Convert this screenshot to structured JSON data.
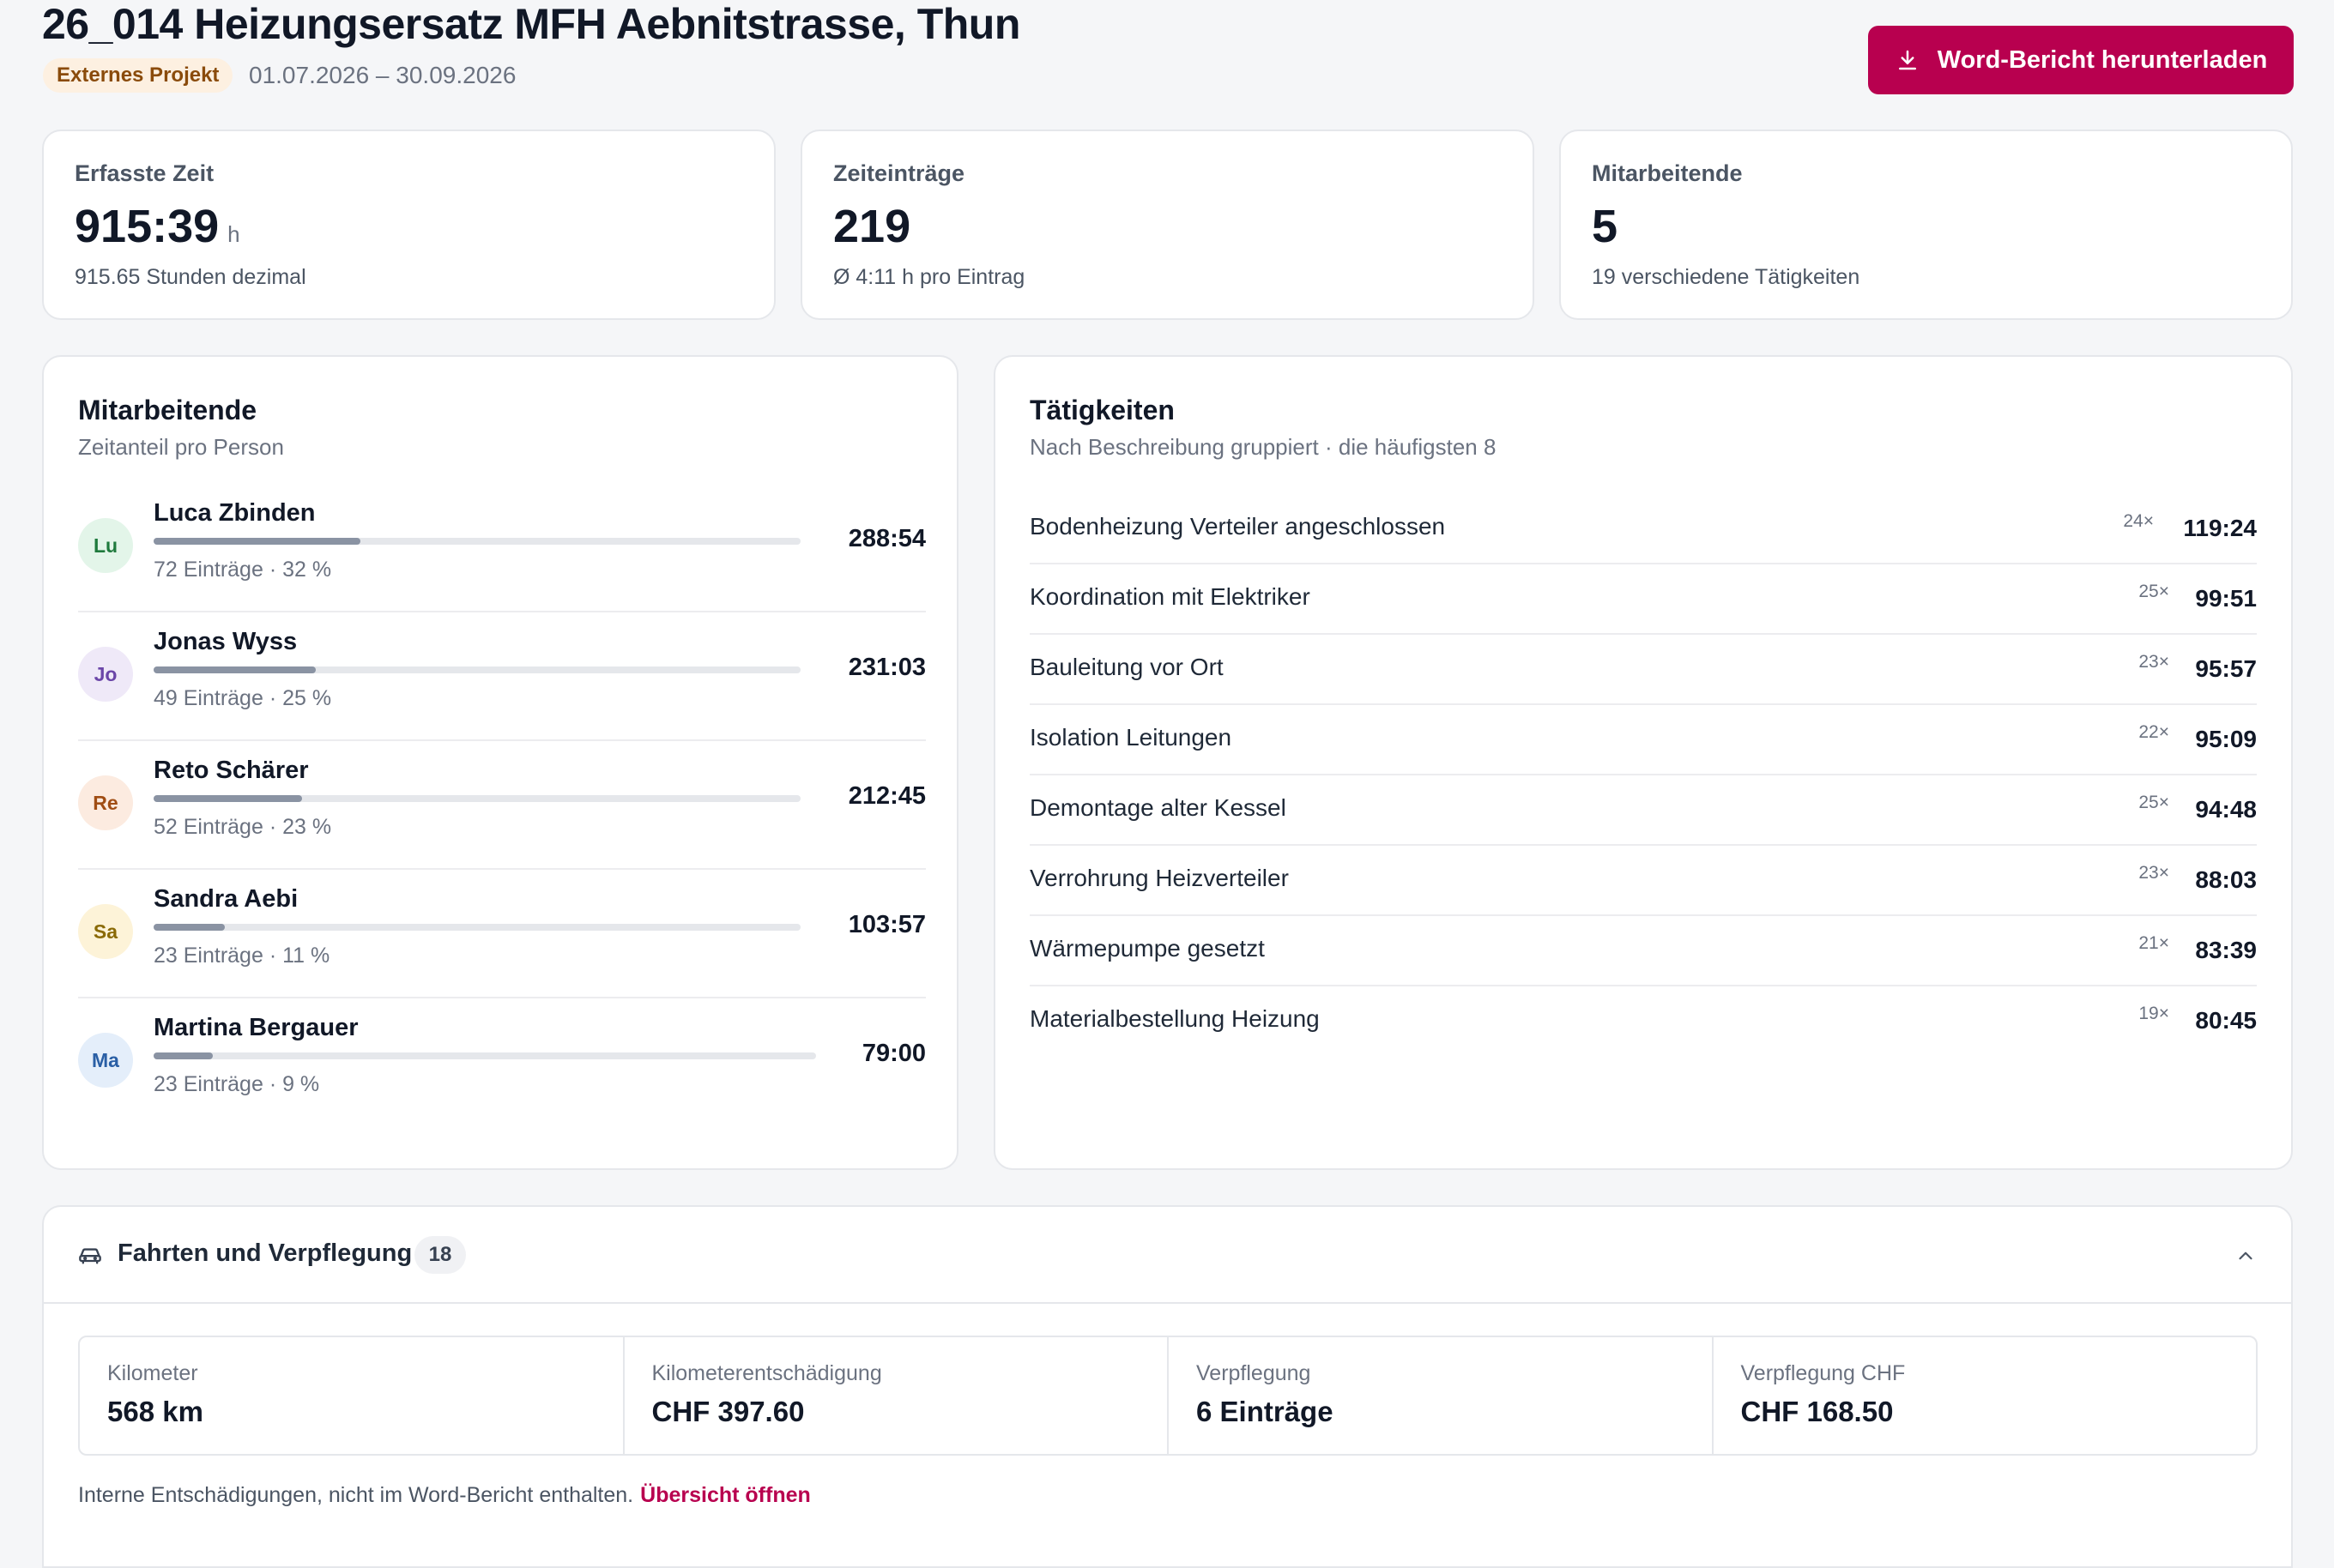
{
  "header": {
    "title": "26_014 Heizungsersatz MFH Aebnitstrasse, Thun",
    "badge": "Externes Projekt",
    "date_range": "01.07.2026 – 30.09.2026",
    "download_button": "Word-Bericht herunterladen",
    "download_icon": "download-icon"
  },
  "stats": [
    {
      "label": "Erfasste Zeit",
      "value": "915:39",
      "unit": "h",
      "sub": "915.65 Stunden dezimal"
    },
    {
      "label": "Zeiteinträge",
      "value": "219",
      "unit": "",
      "sub": "Ø 4:11 h pro Eintrag"
    },
    {
      "label": "Mitarbeitende",
      "value": "5",
      "unit": "",
      "sub": "19 verschiedene Tätigkeiten"
    }
  ],
  "employees": {
    "title": "Mitarbeitende",
    "subtitle": "Zeitanteil pro Person",
    "items": [
      {
        "initials": "Lu",
        "name": "Luca Zbinden",
        "meta": "72 Einträge · 32 %",
        "hours": "288:54",
        "share": 0.32,
        "avatar_bg": "#e3f5e9",
        "avatar_fg": "#1f7a3d"
      },
      {
        "initials": "Jo",
        "name": "Jonas Wyss",
        "meta": "49 Einträge · 25 %",
        "hours": "231:03",
        "share": 0.25,
        "avatar_bg": "#efe9f8",
        "avatar_fg": "#6b46a8"
      },
      {
        "initials": "Re",
        "name": "Reto Schärer",
        "meta": "52 Einträge · 23 %",
        "hours": "212:45",
        "share": 0.23,
        "avatar_bg": "#fcebe0",
        "avatar_fg": "#a04d14"
      },
      {
        "initials": "Sa",
        "name": "Sandra Aebi",
        "meta": "23 Einträge · 11 %",
        "hours": "103:57",
        "share": 0.11,
        "avatar_bg": "#fdf3d8",
        "avatar_fg": "#8a6a06"
      },
      {
        "initials": "Ma",
        "name": "Martina Bergauer",
        "meta": "23 Einträge · 9 %",
        "hours": "79:00",
        "share": 0.09,
        "avatar_bg": "#e4eefa",
        "avatar_fg": "#2a5fa5"
      }
    ]
  },
  "activities": {
    "title": "Tätigkeiten",
    "subtitle": "Nach Beschreibung gruppiert · die häufigsten 8",
    "items": [
      {
        "label": "Bodenheizung Verteiler angeschlossen",
        "count": "24×",
        "hours": "119:24"
      },
      {
        "label": "Koordination mit Elektriker",
        "count": "25×",
        "hours": "99:51"
      },
      {
        "label": "Bauleitung vor Ort",
        "count": "23×",
        "hours": "95:57"
      },
      {
        "label": "Isolation Leitungen",
        "count": "22×",
        "hours": "95:09"
      },
      {
        "label": "Demontage alter Kessel",
        "count": "25×",
        "hours": "94:48"
      },
      {
        "label": "Verrohrung Heizverteiler",
        "count": "23×",
        "hours": "88:03"
      },
      {
        "label": "Wärmepumpe gesetzt",
        "count": "21×",
        "hours": "83:39"
      },
      {
        "label": "Materialbestellung Heizung",
        "count": "19×",
        "hours": "80:45"
      }
    ]
  },
  "fahrten": {
    "title": "Fahrten und Verpflegung",
    "count": "18",
    "cells": [
      {
        "label": "Kilometer",
        "value": "568 km"
      },
      {
        "label": "Kilometerentschädigung",
        "value": "CHF 397.60"
      },
      {
        "label": "Verpflegung",
        "value": "6 Einträge"
      },
      {
        "label": "Verpflegung CHF",
        "value": "CHF 168.50"
      }
    ],
    "footnote": "Interne Entschädigungen, nicht im Word-Bericht enthalten.",
    "link": "Übersicht öffnen"
  },
  "colors": {
    "accent": "#b8004f",
    "bar_fill": "#8a93a3",
    "bar_track": "#e5e7eb"
  }
}
